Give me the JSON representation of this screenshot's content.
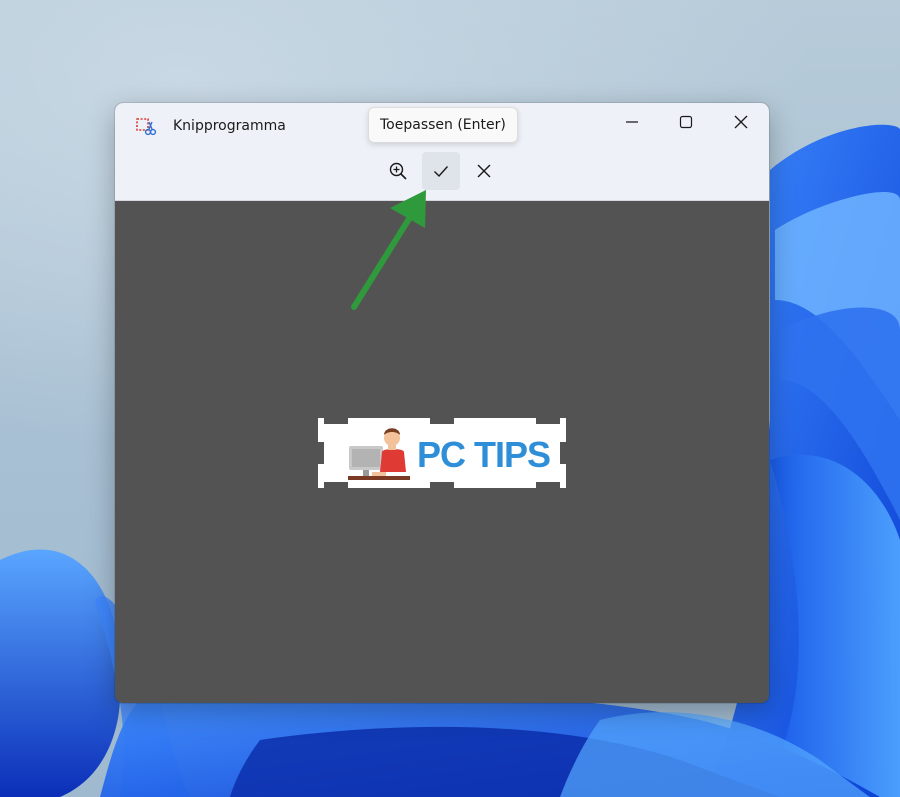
{
  "window": {
    "app_title": "Knipprogramma",
    "app_icon": "snipping-tool-icon"
  },
  "tooltip": {
    "text": "Toepassen (Enter)"
  },
  "toolbar": {
    "zoom_icon": "zoom-in-icon",
    "confirm_icon": "checkmark-icon",
    "discard_icon": "close-icon"
  },
  "snippet": {
    "logo_text": "PC TIPS",
    "brand_color": "#2e8fd8"
  },
  "colors": {
    "arrow": "#2f9a3c",
    "canvas": "#535353",
    "titlebar": "#eef2f8"
  }
}
